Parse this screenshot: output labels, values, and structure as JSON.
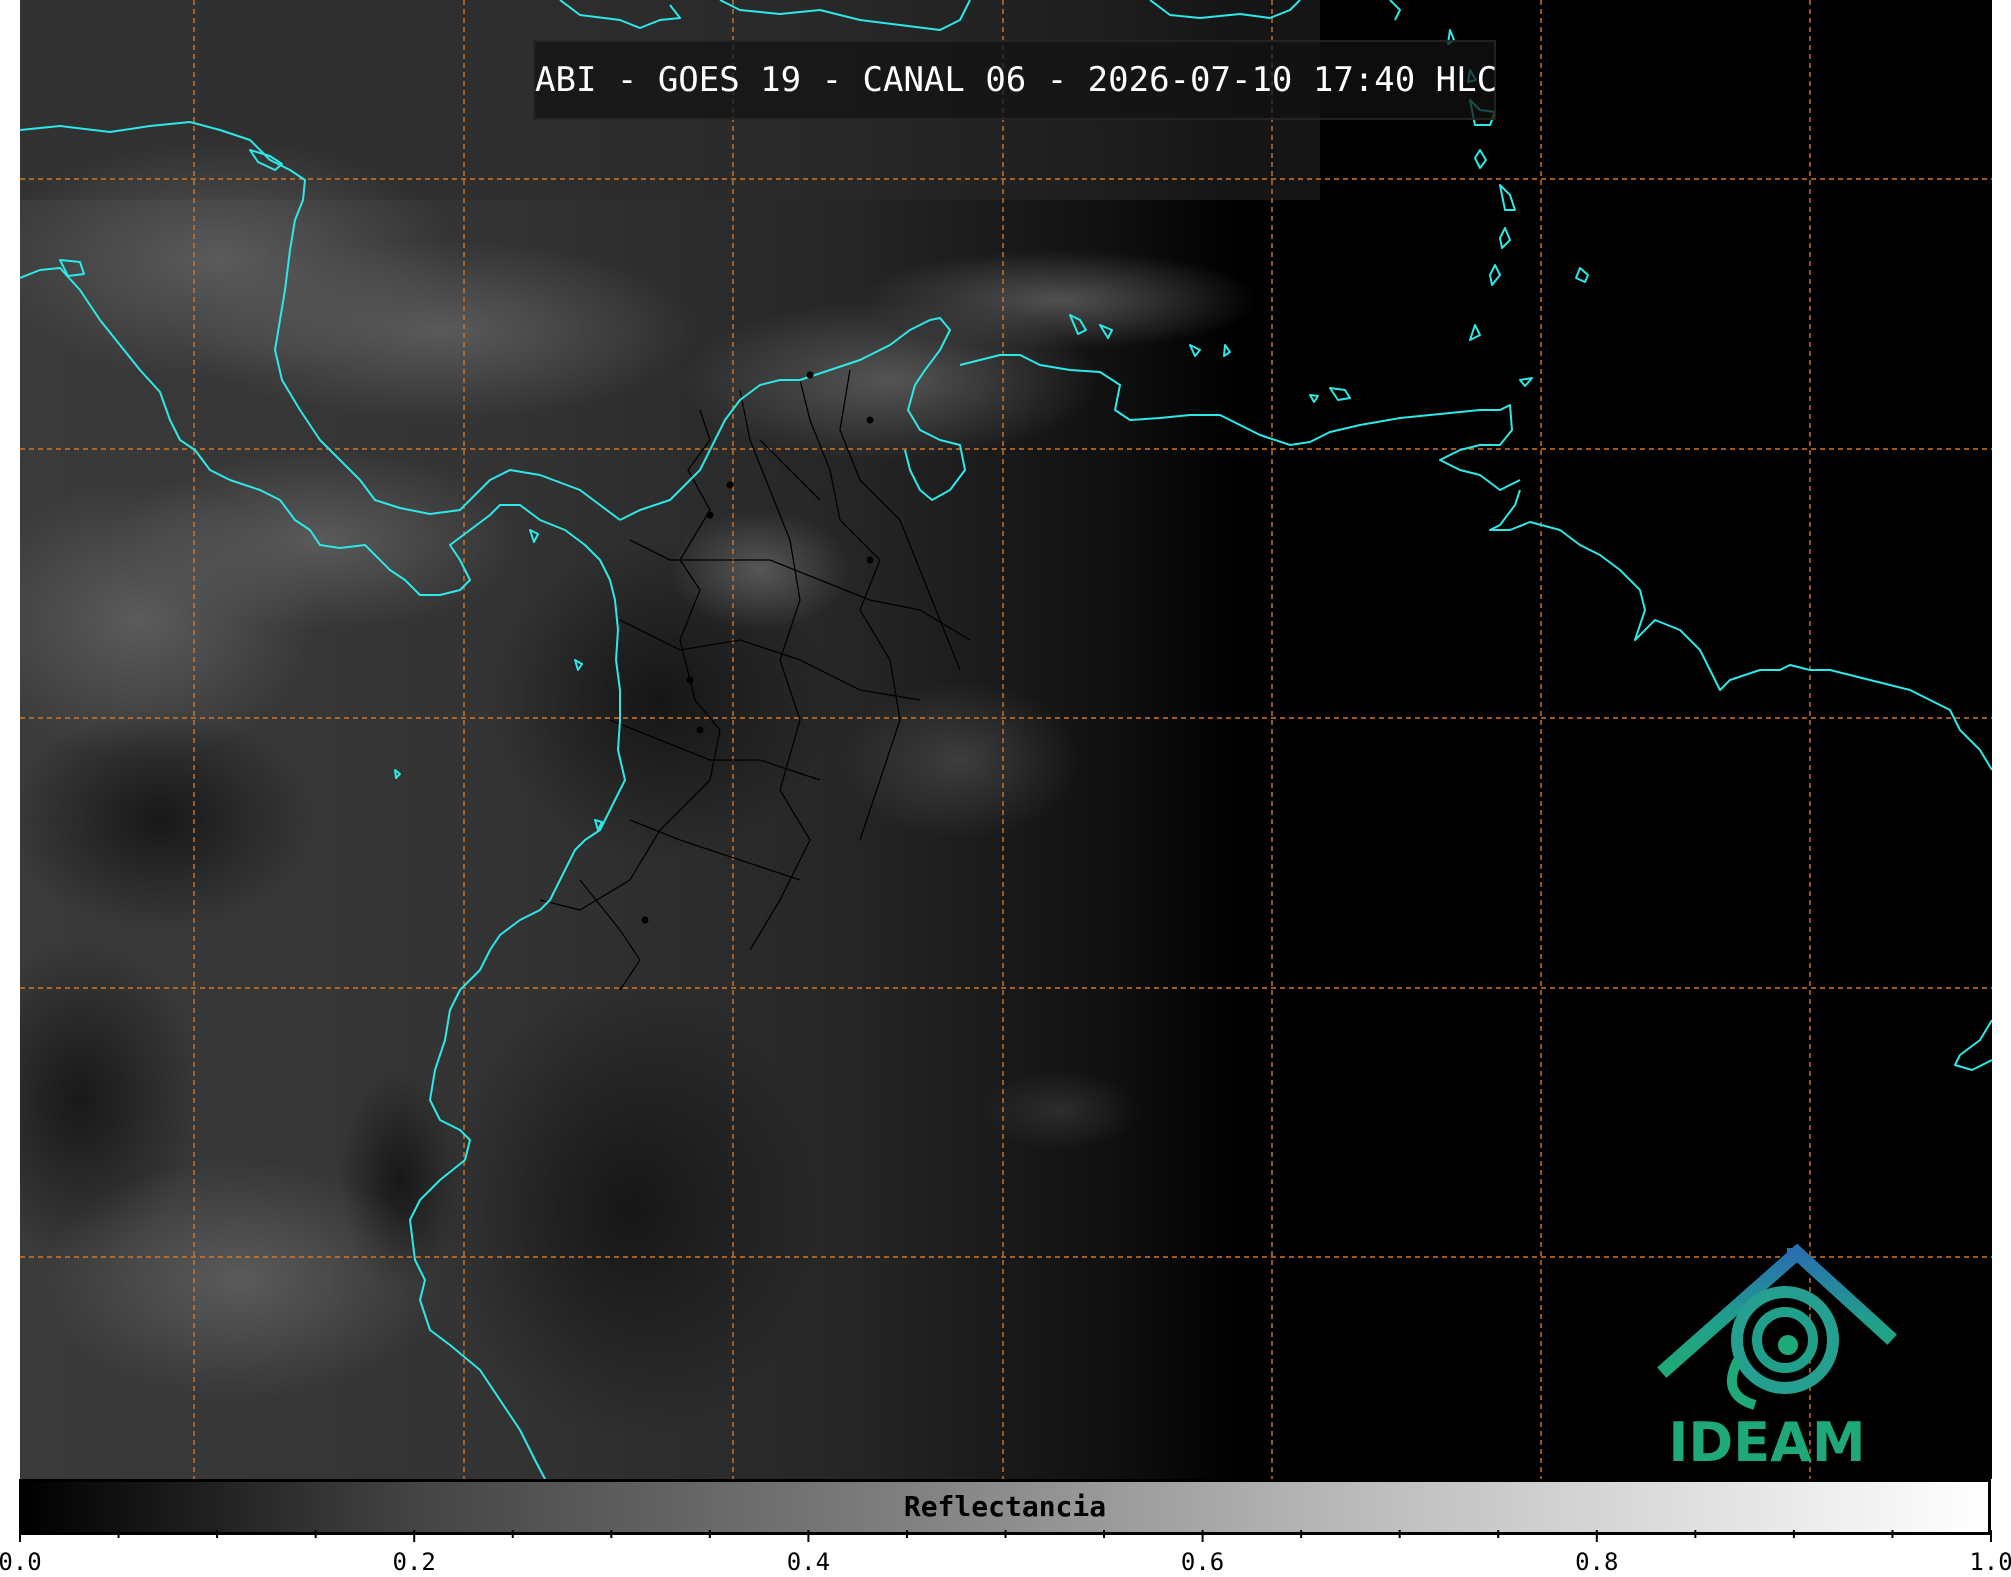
{
  "title": "ABI - GOES 19 - CANAL 06 - 2026-07-10 17:40 HLC",
  "colorbar": {
    "label": "Reflectancia",
    "ticks": [
      "0.0",
      "0.2",
      "0.4",
      "0.6",
      "0.8",
      "1.0"
    ],
    "range": [
      0.0,
      1.0
    ],
    "colors": [
      "#000000",
      "#ffffff"
    ]
  },
  "logo": {
    "text": "IDEAM",
    "color": "#1fa87a"
  },
  "colors": {
    "coastline": "#2ee8e8",
    "gridline": "#d2772a",
    "borders": "#000000",
    "background": "#000000"
  }
}
